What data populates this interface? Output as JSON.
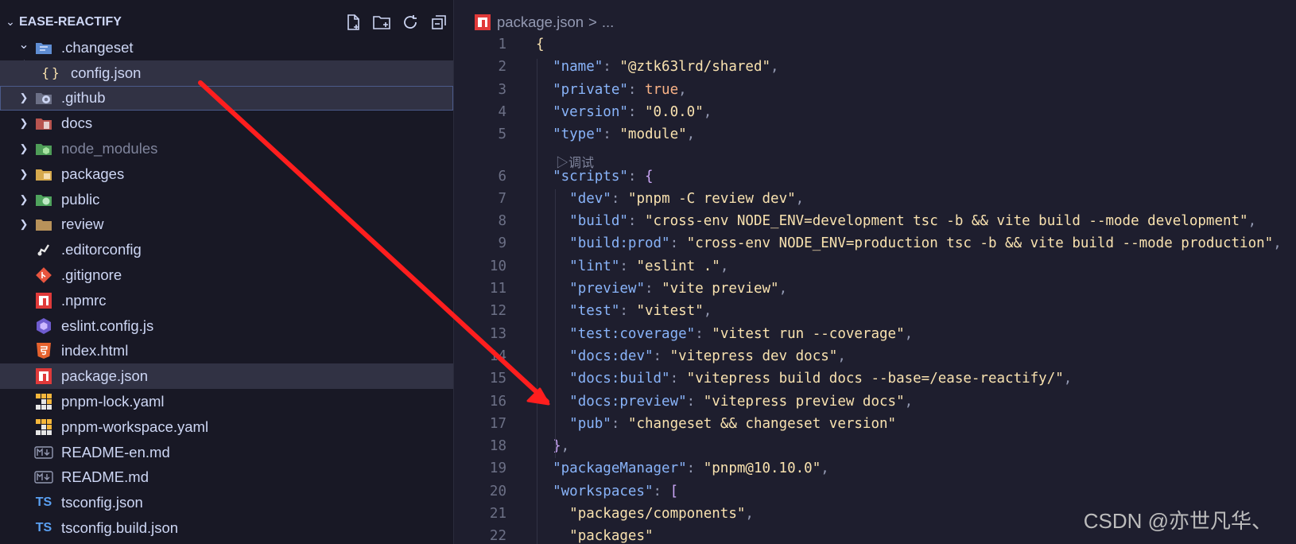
{
  "explorer": {
    "title": "EASE-REACTIFY",
    "items": [
      {
        "label": ".changeset",
        "depth": 0,
        "twisty": "open",
        "icon": "changeset-folder-icon",
        "state": ""
      },
      {
        "label": "config.json",
        "depth": 1,
        "twisty": "none",
        "icon": "json-braces-icon",
        "state": "selected"
      },
      {
        "label": ".github",
        "depth": 0,
        "twisty": "closed",
        "icon": "github-folder-icon",
        "state": "focused"
      },
      {
        "label": "docs",
        "depth": 0,
        "twisty": "closed",
        "icon": "docs-folder-icon",
        "state": ""
      },
      {
        "label": "node_modules",
        "depth": 0,
        "twisty": "closed",
        "icon": "node-modules-folder-icon",
        "state": "dimmed"
      },
      {
        "label": "packages",
        "depth": 0,
        "twisty": "closed",
        "icon": "packages-folder-icon",
        "state": ""
      },
      {
        "label": "public",
        "depth": 0,
        "twisty": "closed",
        "icon": "public-folder-icon",
        "state": ""
      },
      {
        "label": "review",
        "depth": 0,
        "twisty": "closed",
        "icon": "folder-icon",
        "state": ""
      },
      {
        "label": ".editorconfig",
        "depth": 0,
        "twisty": "none",
        "icon": "editorconfig-icon",
        "state": ""
      },
      {
        "label": ".gitignore",
        "depth": 0,
        "twisty": "none",
        "icon": "git-icon",
        "state": ""
      },
      {
        "label": ".npmrc",
        "depth": 0,
        "twisty": "none",
        "icon": "npm-icon",
        "state": ""
      },
      {
        "label": "eslint.config.js",
        "depth": 0,
        "twisty": "none",
        "icon": "eslint-icon",
        "state": ""
      },
      {
        "label": "index.html",
        "depth": 0,
        "twisty": "none",
        "icon": "html5-icon",
        "state": ""
      },
      {
        "label": "package.json",
        "depth": 0,
        "twisty": "none",
        "icon": "npm-icon",
        "state": "selected"
      },
      {
        "label": "pnpm-lock.yaml",
        "depth": 0,
        "twisty": "none",
        "icon": "pnpm-icon",
        "state": ""
      },
      {
        "label": "pnpm-workspace.yaml",
        "depth": 0,
        "twisty": "none",
        "icon": "pnpm-icon",
        "state": ""
      },
      {
        "label": "README-en.md",
        "depth": 0,
        "twisty": "none",
        "icon": "markdown-icon",
        "state": ""
      },
      {
        "label": "README.md",
        "depth": 0,
        "twisty": "none",
        "icon": "markdown-icon",
        "state": ""
      },
      {
        "label": "tsconfig.json",
        "depth": 0,
        "twisty": "none",
        "icon": "typescript-icon",
        "state": ""
      },
      {
        "label": "tsconfig.build.json",
        "depth": 0,
        "twisty": "none",
        "icon": "typescript-icon",
        "state": ""
      }
    ]
  },
  "editor": {
    "breadcrumb": {
      "file": "package.json",
      "separator": ">",
      "more": "..."
    },
    "codelens": "▷调试",
    "lines": [
      {
        "n": "1",
        "t": [
          [
            "b1",
            "{"
          ]
        ]
      },
      {
        "n": "2",
        "t": [
          [
            "p",
            "  "
          ],
          [
            "k",
            "\"name\""
          ],
          [
            "p",
            ": "
          ],
          [
            "sv",
            "\"@ztk63lrd/shared\""
          ],
          [
            "p",
            ","
          ]
        ]
      },
      {
        "n": "3",
        "t": [
          [
            "p",
            "  "
          ],
          [
            "k",
            "\"private\""
          ],
          [
            "p",
            ": "
          ],
          [
            "kw",
            "true"
          ],
          [
            "p",
            ","
          ]
        ]
      },
      {
        "n": "4",
        "t": [
          [
            "p",
            "  "
          ],
          [
            "k",
            "\"version\""
          ],
          [
            "p",
            ": "
          ],
          [
            "sv",
            "\"0.0.0\""
          ],
          [
            "p",
            ","
          ]
        ]
      },
      {
        "n": "5",
        "t": [
          [
            "p",
            "  "
          ],
          [
            "k",
            "\"type\""
          ],
          [
            "p",
            ": "
          ],
          [
            "sv",
            "\"module\""
          ],
          [
            "p",
            ","
          ]
        ]
      },
      {
        "n": "6",
        "t": [
          [
            "p",
            "  "
          ],
          [
            "k",
            "\"scripts\""
          ],
          [
            "p",
            ": "
          ],
          [
            "b2",
            "{"
          ]
        ]
      },
      {
        "n": "7",
        "t": [
          [
            "p",
            "    "
          ],
          [
            "k",
            "\"dev\""
          ],
          [
            "p",
            ": "
          ],
          [
            "sv",
            "\"pnpm -C review dev\""
          ],
          [
            "p",
            ","
          ]
        ]
      },
      {
        "n": "8",
        "t": [
          [
            "p",
            "    "
          ],
          [
            "k",
            "\"build\""
          ],
          [
            "p",
            ": "
          ],
          [
            "sv",
            "\"cross-env NODE_ENV=development tsc -b && vite build --mode development\""
          ],
          [
            "p",
            ","
          ]
        ]
      },
      {
        "n": "9",
        "t": [
          [
            "p",
            "    "
          ],
          [
            "k",
            "\"build:prod\""
          ],
          [
            "p",
            ": "
          ],
          [
            "sv",
            "\"cross-env NODE_ENV=production tsc -b && vite build --mode production\""
          ],
          [
            "p",
            ","
          ]
        ]
      },
      {
        "n": "10",
        "t": [
          [
            "p",
            "    "
          ],
          [
            "k",
            "\"lint\""
          ],
          [
            "p",
            ": "
          ],
          [
            "sv",
            "\"eslint .\""
          ],
          [
            "p",
            ","
          ]
        ]
      },
      {
        "n": "11",
        "t": [
          [
            "p",
            "    "
          ],
          [
            "k",
            "\"preview\""
          ],
          [
            "p",
            ": "
          ],
          [
            "sv",
            "\"vite preview\""
          ],
          [
            "p",
            ","
          ]
        ]
      },
      {
        "n": "12",
        "t": [
          [
            "p",
            "    "
          ],
          [
            "k",
            "\"test\""
          ],
          [
            "p",
            ": "
          ],
          [
            "sv",
            "\"vitest\""
          ],
          [
            "p",
            ","
          ]
        ]
      },
      {
        "n": "13",
        "t": [
          [
            "p",
            "    "
          ],
          [
            "k",
            "\"test:coverage\""
          ],
          [
            "p",
            ": "
          ],
          [
            "sv",
            "\"vitest run --coverage\""
          ],
          [
            "p",
            ","
          ]
        ]
      },
      {
        "n": "14",
        "t": [
          [
            "p",
            "    "
          ],
          [
            "k",
            "\"docs:dev\""
          ],
          [
            "p",
            ": "
          ],
          [
            "sv",
            "\"vitepress dev docs\""
          ],
          [
            "p",
            ","
          ]
        ]
      },
      {
        "n": "15",
        "t": [
          [
            "p",
            "    "
          ],
          [
            "k",
            "\"docs:build\""
          ],
          [
            "p",
            ": "
          ],
          [
            "sv",
            "\"vitepress build docs --base=/ease-reactify/\""
          ],
          [
            "p",
            ","
          ]
        ]
      },
      {
        "n": "16",
        "t": [
          [
            "p",
            "    "
          ],
          [
            "k",
            "\"docs:preview\""
          ],
          [
            "p",
            ": "
          ],
          [
            "sv",
            "\"vitepress preview docs\""
          ],
          [
            "p",
            ","
          ]
        ]
      },
      {
        "n": "17",
        "t": [
          [
            "p",
            "    "
          ],
          [
            "k",
            "\"pub\""
          ],
          [
            "p",
            ": "
          ],
          [
            "sv",
            "\"changeset && changeset version\""
          ]
        ]
      },
      {
        "n": "18",
        "t": [
          [
            "p",
            "  "
          ],
          [
            "b2",
            "}"
          ],
          [
            "p",
            ","
          ]
        ]
      },
      {
        "n": "19",
        "t": [
          [
            "p",
            "  "
          ],
          [
            "k",
            "\"packageManager\""
          ],
          [
            "p",
            ": "
          ],
          [
            "sv",
            "\"pnpm@10.10.0\""
          ],
          [
            "p",
            ","
          ]
        ]
      },
      {
        "n": "20",
        "t": [
          [
            "p",
            "  "
          ],
          [
            "k",
            "\"workspaces\""
          ],
          [
            "p",
            ": "
          ],
          [
            "b2",
            "["
          ]
        ]
      },
      {
        "n": "21",
        "t": [
          [
            "p",
            "    "
          ],
          [
            "sv",
            "\"packages/components\""
          ],
          [
            "p",
            ","
          ]
        ]
      },
      {
        "n": "22",
        "t": [
          [
            "p",
            "    "
          ],
          [
            "sv",
            "\"packages\""
          ]
        ]
      }
    ]
  },
  "watermark": "CSDN @亦世凡华、",
  "colors": {
    "arrow": "#ff1e1e",
    "accent": "#89b4fa"
  }
}
